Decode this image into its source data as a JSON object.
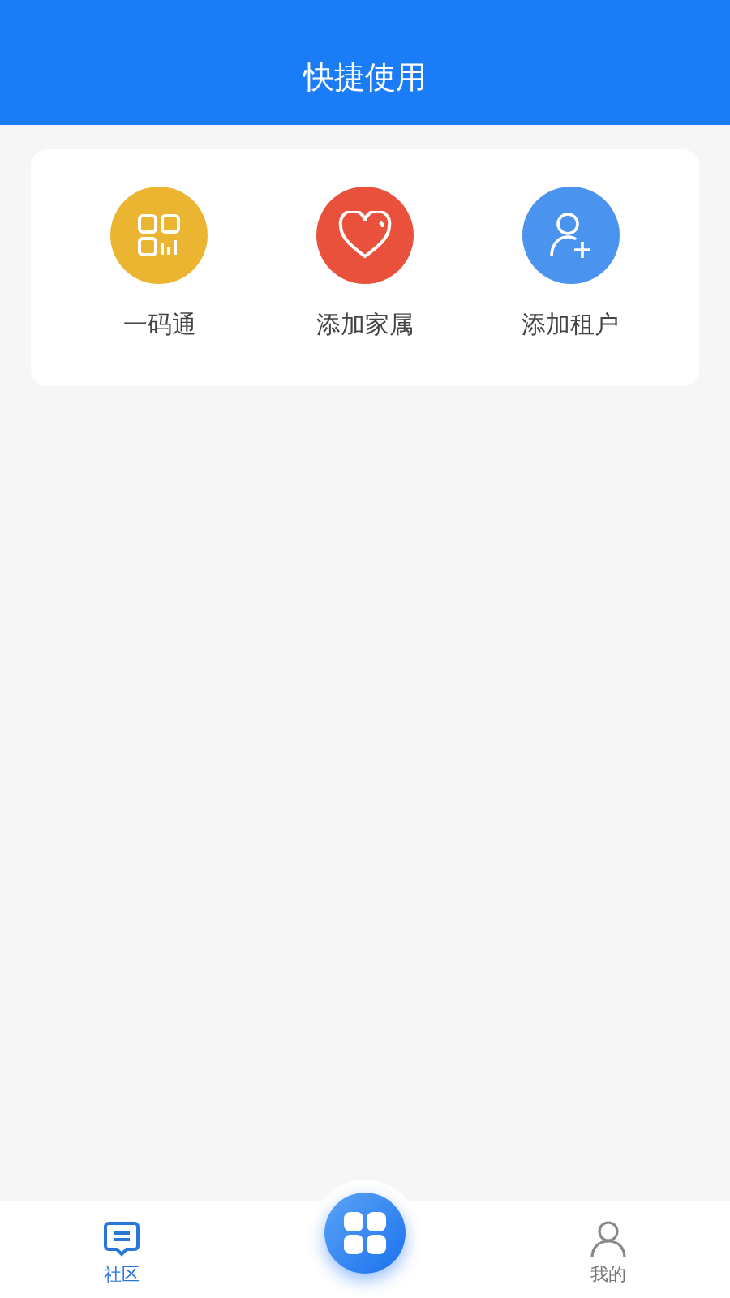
{
  "header": {
    "title": "快捷使用"
  },
  "shortcuts": [
    {
      "kind": "code",
      "label": "一码通",
      "color": "#ebb532"
    },
    {
      "kind": "heart",
      "label": "添加家属",
      "color": "#e9513c"
    },
    {
      "kind": "adduser",
      "label": "添加租户",
      "color": "#4a93ee"
    }
  ],
  "tabbar": [
    {
      "kind": "chat",
      "label": "社区",
      "selected": true
    },
    {
      "kind": "center"
    },
    {
      "kind": "user",
      "label": "我的",
      "selected": false
    }
  ]
}
